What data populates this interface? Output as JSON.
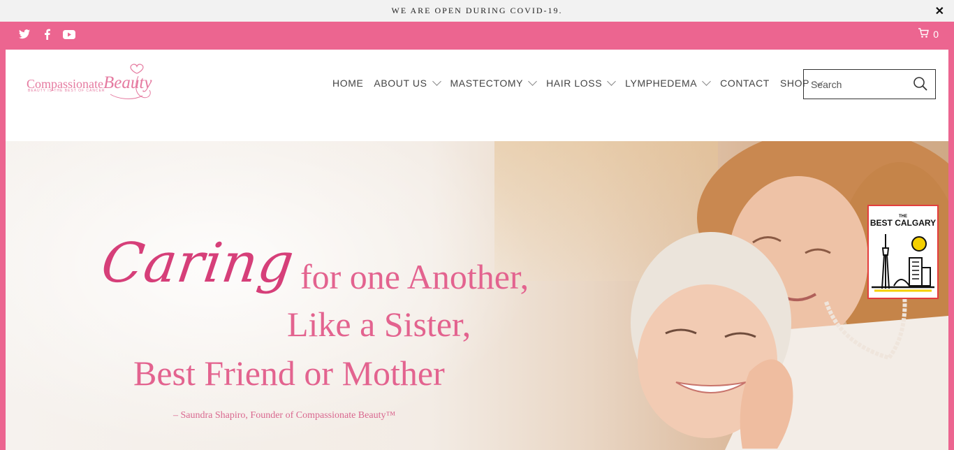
{
  "announcement": {
    "text": "WE ARE OPEN DURING COVID-19.",
    "close_label": "✕"
  },
  "social": {
    "icons": [
      "twitter-icon",
      "facebook-icon",
      "youtube-icon"
    ]
  },
  "cart": {
    "count": "0",
    "icon": "cart-icon"
  },
  "logo": {
    "main": "Compassionate",
    "script": "Beauty",
    "tagline": "BEAUTY IS THE BEST OF CANCER"
  },
  "nav": {
    "home": "HOME",
    "about": "ABOUT US",
    "mastectomy": "MASTECTOMY",
    "hair_loss": "HAIR LOSS",
    "lymphedema": "LYMPHEDEMA",
    "contact": "CONTACT",
    "shop": "SHOP"
  },
  "search": {
    "placeholder": "Search",
    "value": ""
  },
  "hero": {
    "caring": "Caring",
    "line1": "for one Another,",
    "line2": "Like a Sister,",
    "line3": "Best Friend or Mother",
    "attribution": "– Saundra Shapiro, Founder of Compassionate Beauty™"
  },
  "badge": {
    "small": "THE",
    "label": "BEST CALGARY"
  },
  "colors": {
    "brand_pink": "#ec6590",
    "headline_pink": "#e3638f",
    "badge_border": "#e33d3d",
    "badge_sun": "#f5d000"
  }
}
